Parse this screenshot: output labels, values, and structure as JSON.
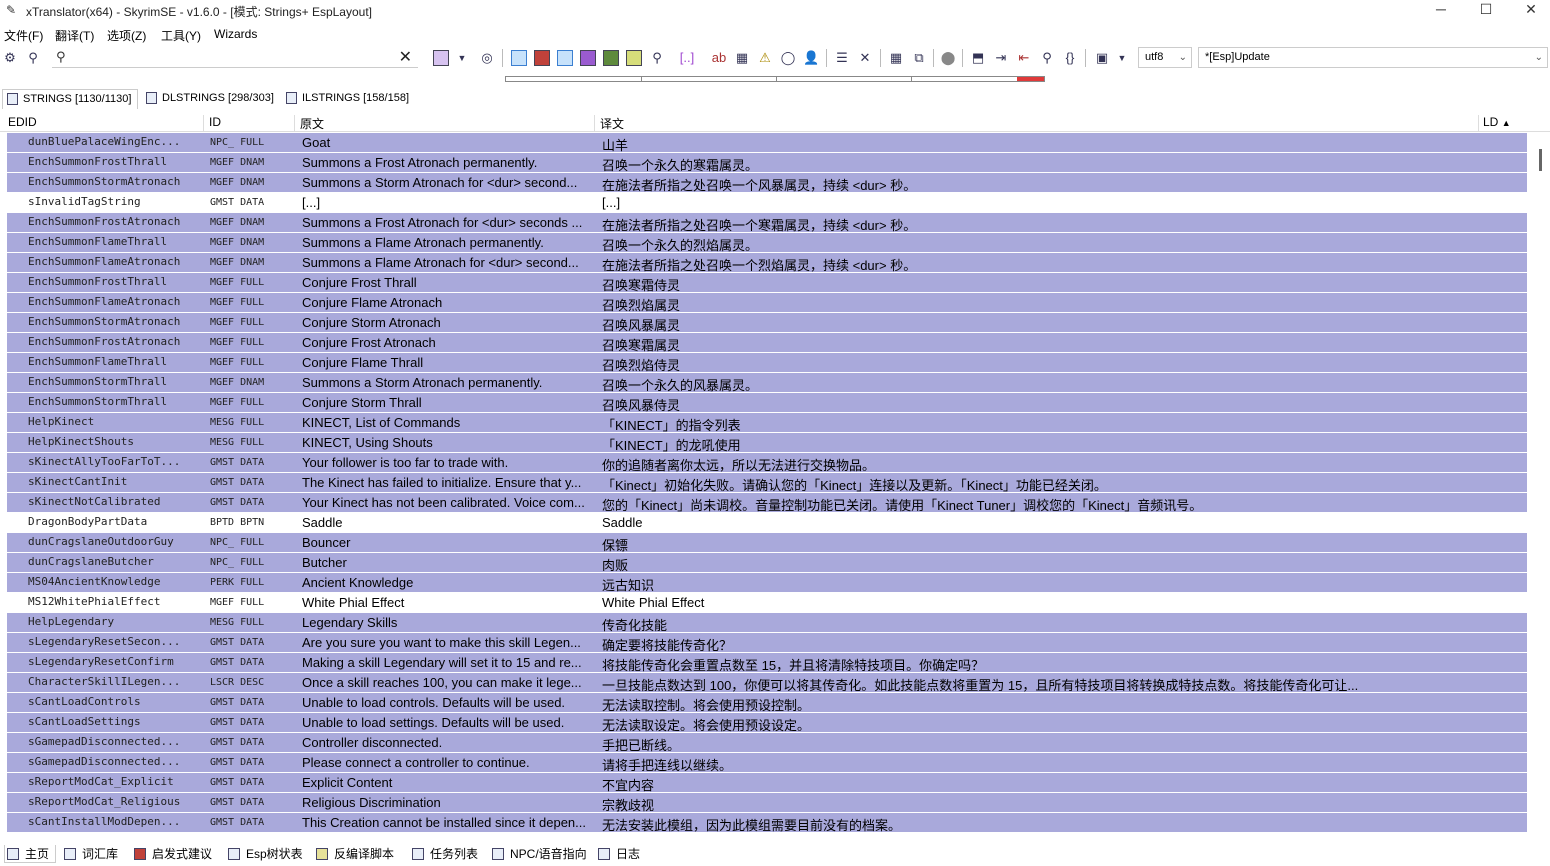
{
  "window": {
    "title": "xTranslator(x64) - SkyrimSE - v1.6.0 - [模式: Strings+ EspLayout]",
    "minimize": "─",
    "maximize": "☐",
    "close": "✕"
  },
  "menu": [
    {
      "label": "文件(F)"
    },
    {
      "label": "翻译(T)"
    },
    {
      "label": "选项(Z)"
    },
    {
      "label": "工具(Y)"
    },
    {
      "label": "Wizards"
    }
  ],
  "toolbar": {
    "search_placeholder": "",
    "encoding": "utf8",
    "mode": "*[Esp]Update"
  },
  "progress": {
    "translated_fraction": 0.95
  },
  "tabs": [
    {
      "label": "STRINGS [1130/1130]"
    },
    {
      "label": "DLSTRINGS [298/303]"
    },
    {
      "label": "ILSTRINGS [158/158]"
    }
  ],
  "columns": {
    "edid": "EDID",
    "id": "ID",
    "source": "原文",
    "translation": "译文",
    "ld": "LD"
  },
  "rows": [
    {
      "edid": "dunBluePalaceWingEnc...",
      "id": "NPC_ FULL",
      "src": "Goat",
      "tr": "山羊",
      "hl": true
    },
    {
      "edid": "EnchSummonFrostThrall",
      "id": "MGEF DNAM",
      "src": "Summons a Frost Atronach permanently.",
      "tr": "召唤一个永久的寒霜属灵。",
      "hl": true
    },
    {
      "edid": "EnchSummonStormAtronach",
      "id": "MGEF DNAM",
      "src": "Summons a Storm Atronach for <dur> second...",
      "tr": "在施法者所指之处召唤一个风暴属灵，持续 <dur> 秒。",
      "hl": true
    },
    {
      "edid": "sInvalidTagString",
      "id": "GMST DATA",
      "src": "[...]",
      "tr": "[...]",
      "hl": false
    },
    {
      "edid": "EnchSummonFrostAtronach",
      "id": "MGEF DNAM",
      "src": "Summons a Frost Atronach for <dur> seconds ...",
      "tr": "在施法者所指之处召唤一个寒霜属灵，持续 <dur> 秒。",
      "hl": true
    },
    {
      "edid": "EnchSummonFlameThrall",
      "id": "MGEF DNAM",
      "src": "Summons a Flame Atronach permanently.",
      "tr": "召唤一个永久的烈焰属灵。",
      "hl": true
    },
    {
      "edid": "EnchSummonFlameAtronach",
      "id": "MGEF DNAM",
      "src": "Summons a Flame Atronach for <dur> second...",
      "tr": "在施法者所指之处召唤一个烈焰属灵，持续 <dur> 秒。",
      "hl": true
    },
    {
      "edid": "EnchSummonFrostThrall",
      "id": "MGEF FULL",
      "src": "Conjure Frost Thrall",
      "tr": "召唤寒霜侍灵",
      "hl": true
    },
    {
      "edid": "EnchSummonFlameAtronach",
      "id": "MGEF FULL",
      "src": "Conjure Flame Atronach",
      "tr": "召唤烈焰属灵",
      "hl": true
    },
    {
      "edid": "EnchSummonStormAtronach",
      "id": "MGEF FULL",
      "src": "Conjure Storm Atronach",
      "tr": "召唤风暴属灵",
      "hl": true
    },
    {
      "edid": "EnchSummonFrostAtronach",
      "id": "MGEF FULL",
      "src": "Conjure Frost Atronach",
      "tr": "召唤寒霜属灵",
      "hl": true
    },
    {
      "edid": "EnchSummonFlameThrall",
      "id": "MGEF FULL",
      "src": "Conjure Flame Thrall",
      "tr": "召唤烈焰侍灵",
      "hl": true
    },
    {
      "edid": "EnchSummonStormThrall",
      "id": "MGEF DNAM",
      "src": "Summons a Storm Atronach permanently.",
      "tr": "召唤一个永久的风暴属灵。",
      "hl": true
    },
    {
      "edid": "EnchSummonStormThrall",
      "id": "MGEF FULL",
      "src": "Conjure Storm Thrall",
      "tr": "召唤风暴侍灵",
      "hl": true
    },
    {
      "edid": "HelpKinect",
      "id": "MESG FULL",
      "src": "KINECT, List of Commands",
      "tr": "「KINECT」的指令列表",
      "hl": true
    },
    {
      "edid": "HelpKinectShouts",
      "id": "MESG FULL",
      "src": "KINECT, Using Shouts",
      "tr": "「KINECT」的龙吼使用",
      "hl": true
    },
    {
      "edid": "sKinectAllyTooFarToT...",
      "id": "GMST DATA",
      "src": "Your follower is too far to trade with.",
      "tr": "你的追随者离你太远，所以无法进行交换物品。",
      "hl": true
    },
    {
      "edid": "sKinectCantInit",
      "id": "GMST DATA",
      "src": "The Kinect has failed to initialize.  Ensure that y...",
      "tr": "「Kinect」初始化失败。请确认您的「Kinect」连接以及更新。「Kinect」功能已经关闭。",
      "hl": true
    },
    {
      "edid": "sKinectNotCalibrated",
      "id": "GMST DATA",
      "src": "Your Kinect has not been calibrated. Voice com...",
      "tr": "您的「Kinect」尚未调校。音量控制功能已关闭。请使用「Kinect Tuner」调校您的「Kinect」音频讯号。",
      "hl": true
    },
    {
      "edid": "DragonBodyPartData",
      "id": "BPTD BPTN",
      "src": "Saddle",
      "tr": "Saddle",
      "hl": false
    },
    {
      "edid": "dunCragslaneOutdoorGuy",
      "id": "NPC_ FULL",
      "src": "Bouncer",
      "tr": "保镖",
      "hl": true
    },
    {
      "edid": "dunCragslaneButcher",
      "id": "NPC_ FULL",
      "src": "Butcher",
      "tr": "肉贩",
      "hl": true
    },
    {
      "edid": "MS04AncientKnowledge",
      "id": "PERK FULL",
      "src": "Ancient Knowledge",
      "tr": "远古知识",
      "hl": true
    },
    {
      "edid": "MS12WhitePhialEffect",
      "id": "MGEF FULL",
      "src": "White Phial Effect",
      "tr": "White Phial Effect",
      "hl": false
    },
    {
      "edid": "HelpLegendary",
      "id": "MESG FULL",
      "src": "Legendary Skills",
      "tr": "传奇化技能",
      "hl": true
    },
    {
      "edid": "sLegendaryResetSecon...",
      "id": "GMST DATA",
      "src": "Are you sure you want to make this skill Legen...",
      "tr": "确定要将技能传奇化？",
      "hl": true
    },
    {
      "edid": "sLegendaryResetConfirm",
      "id": "GMST DATA",
      "src": "Making a skill Legendary will set it to 15 and re...",
      "tr": "将技能传奇化会重置点数至 15，并且将清除特技项目。你确定吗？",
      "hl": true
    },
    {
      "edid": "CharacterSkillILegen...",
      "id": "LSCR DESC",
      "src": "Once a skill reaches 100, you can make it lege...",
      "tr": "一旦技能点数达到 100，你便可以将其传奇化。如此技能点数将重置为 15，且所有特技项目将转换成特技点数。将技能传奇化可让...",
      "hl": true
    },
    {
      "edid": "sCantLoadControls",
      "id": "GMST DATA",
      "src": "Unable to load controls. Defaults will be used.",
      "tr": "无法读取控制。将会使用预设控制。",
      "hl": true
    },
    {
      "edid": "sCantLoadSettings",
      "id": "GMST DATA",
      "src": "Unable to load settings. Defaults will be used.",
      "tr": "无法读取设定。将会使用预设设定。",
      "hl": true
    },
    {
      "edid": "sGamepadDisconnected...",
      "id": "GMST DATA",
      "src": "Controller disconnected.",
      "tr": "手把已断线。",
      "hl": true
    },
    {
      "edid": "sGamepadDisconnected...",
      "id": "GMST DATA",
      "src": "Please connect a controller to continue.",
      "tr": "请将手把连线以继续。",
      "hl": true
    },
    {
      "edid": "sReportModCat_Explicit",
      "id": "GMST DATA",
      "src": "Explicit Content",
      "tr": "不宜内容",
      "hl": true
    },
    {
      "edid": "sReportModCat_Religious",
      "id": "GMST DATA",
      "src": "Religious Discrimination",
      "tr": "宗教歧视",
      "hl": true
    },
    {
      "edid": "sCantInstallModDepen...",
      "id": "GMST DATA",
      "src": "This Creation cannot be installed since it depen...",
      "tr": "无法安装此模组，因为此模组需要目前没有的档案。",
      "hl": true
    }
  ],
  "bottom_tabs": [
    {
      "label": "主页"
    },
    {
      "label": "词汇库"
    },
    {
      "label": "启发式建议"
    },
    {
      "label": "Esp树状表"
    },
    {
      "label": "反编译脚本"
    },
    {
      "label": "任务列表"
    },
    {
      "label": "NPC/语音指向"
    },
    {
      "label": "日志"
    }
  ],
  "colors": {
    "row_highlight": "#a9a9db",
    "progress_red": "#e03a3a"
  }
}
